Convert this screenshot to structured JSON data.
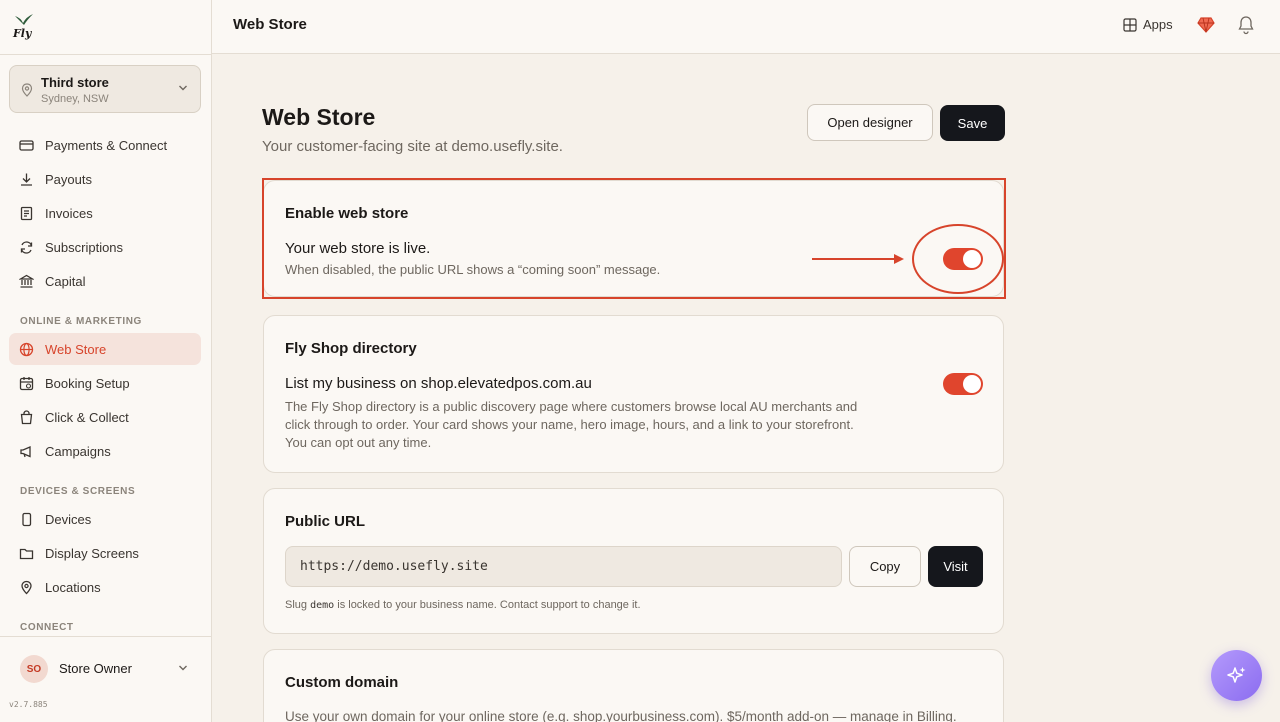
{
  "brand": {
    "logo_text": "Fly"
  },
  "topbar": {
    "title": "Web Store",
    "apps_label": "Apps"
  },
  "store": {
    "name": "Third store",
    "location": "Sydney, NSW"
  },
  "sidebar": {
    "items": [
      {
        "label": "Payments & Connect",
        "icon": "card-icon"
      },
      {
        "label": "Payouts",
        "icon": "download-icon"
      },
      {
        "label": "Invoices",
        "icon": "invoice-icon"
      },
      {
        "label": "Subscriptions",
        "icon": "refresh-icon"
      },
      {
        "label": "Capital",
        "icon": "bank-icon"
      }
    ],
    "sections": [
      {
        "label": "ONLINE & MARKETING",
        "items": [
          {
            "label": "Web Store",
            "icon": "globe-icon",
            "active": true
          },
          {
            "label": "Booking Setup",
            "icon": "calendar-icon"
          },
          {
            "label": "Click & Collect",
            "icon": "bag-icon"
          },
          {
            "label": "Campaigns",
            "icon": "megaphone-icon"
          }
        ]
      },
      {
        "label": "DEVICES & SCREENS",
        "items": [
          {
            "label": "Devices",
            "icon": "phone-icon"
          },
          {
            "label": "Display Screens",
            "icon": "folder-icon"
          },
          {
            "label": "Locations",
            "icon": "pin-icon"
          }
        ]
      },
      {
        "label": "CONNECT",
        "items": []
      }
    ]
  },
  "user": {
    "initials": "SO",
    "name": "Store Owner"
  },
  "version": "v2.7.885",
  "page": {
    "title": "Web Store",
    "subtitle": "Your customer-facing site at demo.usefly.site.",
    "open_designer_label": "Open designer",
    "save_label": "Save"
  },
  "cards": {
    "enable": {
      "title": "Enable web store",
      "status": "Your web store is live.",
      "desc": "When disabled, the public URL shows a “coming soon” message.",
      "enabled": true
    },
    "directory": {
      "title": "Fly Shop directory",
      "heading": "List my business on shop.elevatedpos.com.au",
      "desc_line1": "The Fly Shop directory is a public discovery page where customers browse local AU merchants and",
      "desc_line2": "click through to order. Your card shows your name, hero image, hours, and a link to your storefront.",
      "desc_line3": "You can opt out any time.",
      "enabled": true
    },
    "public_url": {
      "title": "Public URL",
      "url": "https://demo.usefly.site",
      "copy_label": "Copy",
      "visit_label": "Visit",
      "note_prefix": "Slug",
      "note_slug": "demo",
      "note_suffix": "is locked to your business name. Contact support to change it."
    },
    "custom_domain": {
      "title": "Custom domain",
      "desc": "Use your own domain for your online store (e.g. shop.yourbusiness.com). $5/month add-on — manage in",
      "billing_link": "Billing",
      "desc_end": "."
    }
  },
  "colors": {
    "accent": "#e0452d",
    "dark": "#15171c",
    "annotation": "#d7442b"
  }
}
